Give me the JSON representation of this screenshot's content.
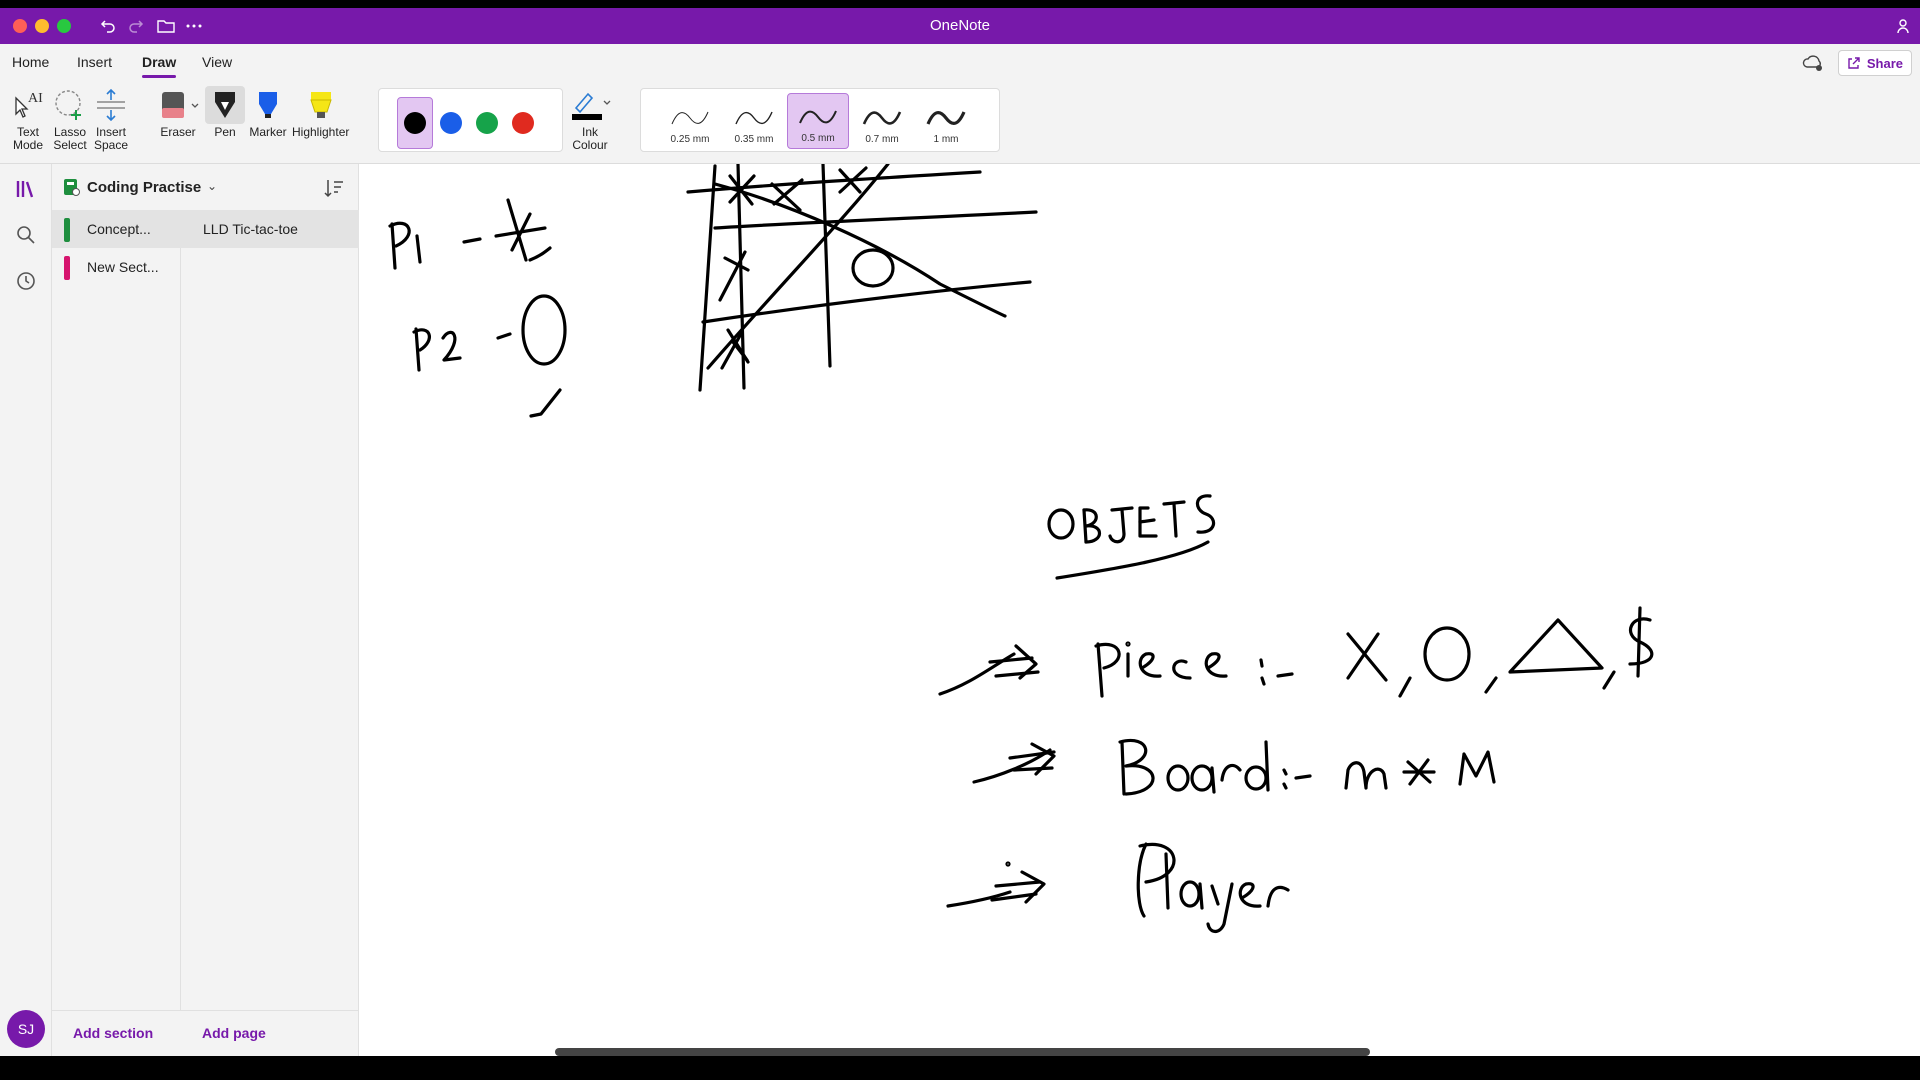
{
  "titlebar": {
    "app_title": "OneNote"
  },
  "ribbon_tabs": [
    {
      "label": "Home",
      "active": false
    },
    {
      "label": "Insert",
      "active": false
    },
    {
      "label": "Draw",
      "active": true
    },
    {
      "label": "View",
      "active": false
    }
  ],
  "share": {
    "label": "Share"
  },
  "tools": {
    "text_mode": [
      "Text",
      "Mode"
    ],
    "lasso_select": [
      "Lasso",
      "Select"
    ],
    "insert_space": [
      "Insert",
      "Space"
    ],
    "eraser": "Eraser",
    "pen": "Pen",
    "marker": "Marker",
    "highlighter": "Highlighter",
    "ink_colour": [
      "Ink",
      "Colour"
    ]
  },
  "pen_colors": [
    "#000000",
    "#1a5ee8",
    "#16a34a",
    "#e02a1f"
  ],
  "accent_color": "#7719aa",
  "thickness": [
    {
      "label": "0.25 mm",
      "selected": false
    },
    {
      "label": "0.35 mm",
      "selected": false
    },
    {
      "label": "0.5 mm",
      "selected": true
    },
    {
      "label": "0.7 mm",
      "selected": false
    },
    {
      "label": "1 mm",
      "selected": false
    }
  ],
  "notebook": {
    "name": "Coding Practise"
  },
  "sections": [
    {
      "label": "Concept...",
      "color": "#1e8e3e",
      "selected": true
    },
    {
      "label": "New Sect...",
      "color": "#d6146e",
      "selected": false
    }
  ],
  "pages": [
    {
      "label": "LLD Tic-tac-toe",
      "selected": true
    }
  ],
  "footer": {
    "add_section": "Add section",
    "add_page": "Add page"
  },
  "user": {
    "initials": "SJ"
  }
}
